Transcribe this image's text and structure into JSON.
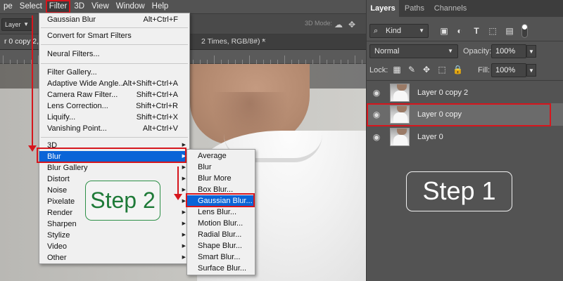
{
  "menubar": {
    "items": [
      "pe",
      "Select",
      "Filter",
      "3D",
      "View",
      "Window",
      "Help"
    ],
    "active": "Filter"
  },
  "options": {
    "layer_dropdown": "Layer",
    "mode_3d": "3D Mode:"
  },
  "document": {
    "tab_left": "r 0 copy 2, R",
    "tab_right": "2 Times, RGB/8#) *",
    "close": "×"
  },
  "filter_menu": {
    "items": [
      {
        "label": "Gaussian Blur",
        "shortcut": "Alt+Ctrl+F"
      },
      {
        "label": "Convert for Smart Filters",
        "shortcut": ""
      },
      {
        "label": "Neural Filters...",
        "shortcut": ""
      },
      {
        "label": "Filter Gallery...",
        "shortcut": ""
      },
      {
        "label": "Adaptive Wide Angle...",
        "shortcut": "Alt+Shift+Ctrl+A"
      },
      {
        "label": "Camera Raw Filter...",
        "shortcut": "Shift+Ctrl+A"
      },
      {
        "label": "Lens Correction...",
        "shortcut": "Shift+Ctrl+R"
      },
      {
        "label": "Liquify...",
        "shortcut": "Shift+Ctrl+X"
      },
      {
        "label": "Vanishing Point...",
        "shortcut": "Alt+Ctrl+V"
      },
      {
        "label": "3D",
        "shortcut": ""
      },
      {
        "label": "Blur",
        "shortcut": ""
      },
      {
        "label": "Blur Gallery",
        "shortcut": ""
      },
      {
        "label": "Distort",
        "shortcut": ""
      },
      {
        "label": "Noise",
        "shortcut": ""
      },
      {
        "label": "Pixelate",
        "shortcut": ""
      },
      {
        "label": "Render",
        "shortcut": ""
      },
      {
        "label": "Sharpen",
        "shortcut": ""
      },
      {
        "label": "Stylize",
        "shortcut": ""
      },
      {
        "label": "Video",
        "shortcut": ""
      },
      {
        "label": "Other",
        "shortcut": ""
      }
    ],
    "highlighted": "Blur"
  },
  "blur_menu": {
    "items": [
      "Average",
      "Blur",
      "Blur More",
      "Box Blur...",
      "Gaussian Blur...",
      "Lens Blur...",
      "Motion Blur...",
      "Radial Blur...",
      "Shape Blur...",
      "Smart Blur...",
      "Surface Blur..."
    ],
    "highlighted": "Gaussian Blur..."
  },
  "steps": {
    "step1": "Step 1",
    "step2": "Step 2"
  },
  "panel": {
    "tabs": [
      "Layers",
      "Paths",
      "Channels"
    ],
    "active_tab": "Layers",
    "kind_label": "Kind",
    "blend_mode": "Normal",
    "opacity_label": "Opacity:",
    "opacity_value": "100%",
    "lock_label": "Lock:",
    "fill_label": "Fill:",
    "fill_value": "100%",
    "layers": [
      {
        "name": "Layer 0 copy 2",
        "selected": false
      },
      {
        "name": "Layer 0 copy",
        "selected": true
      },
      {
        "name": "Layer 0",
        "selected": false
      }
    ]
  },
  "colors": {
    "highlight": "#0a64d7",
    "annotation_red": "#d6161d",
    "step2_green": "#1f7a38"
  }
}
